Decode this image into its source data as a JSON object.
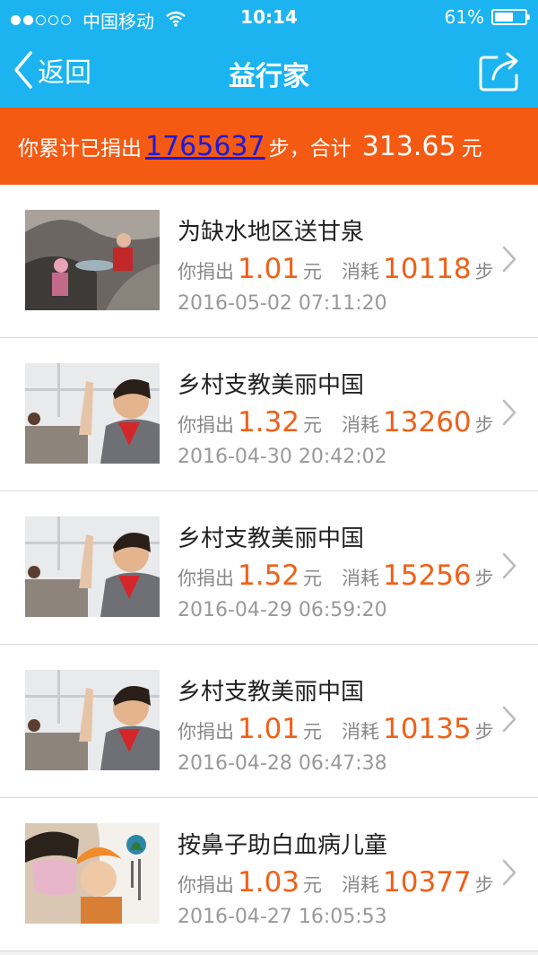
{
  "status_bar": {
    "carrier": "中国移动",
    "time": "10:14",
    "battery": "61%",
    "battery_level": 0.61,
    "signal_bars": 2
  },
  "nav": {
    "back_label": "返回",
    "title": "益行家"
  },
  "summary": {
    "prefix": "你累计已捐出",
    "steps": "1765637",
    "steps_unit": "步，合计",
    "amount": "313.65",
    "amount_unit": "元"
  },
  "labels": {
    "donated": "你捐出",
    "yuan": "元",
    "consumed": "消耗",
    "steps": "步"
  },
  "items": [
    {
      "title": "为缺水地区送甘泉",
      "amount": "1.01",
      "steps": "10118",
      "date": "2016-05-02 07:11:20",
      "image": "water-project-photo"
    },
    {
      "title": "乡村支教美丽中国",
      "amount": "1.32",
      "steps": "13260",
      "date": "2016-04-30 20:42:02",
      "image": "student-raising-hand-photo"
    },
    {
      "title": "乡村支教美丽中国",
      "amount": "1.52",
      "steps": "15256",
      "date": "2016-04-29 06:59:20",
      "image": "student-raising-hand-photo"
    },
    {
      "title": "乡村支教美丽中国",
      "amount": "1.01",
      "steps": "10135",
      "date": "2016-04-28 06:47:38",
      "image": "student-raising-hand-photo"
    },
    {
      "title": "按鼻子助白血病儿童",
      "amount": "1.03",
      "steps": "10377",
      "date": "2016-04-27 16:05:53",
      "image": "leukemia-child-photo"
    }
  ],
  "colors": {
    "header": "#1bb4f0",
    "summary": "#f55a13",
    "accent": "#f06018"
  }
}
